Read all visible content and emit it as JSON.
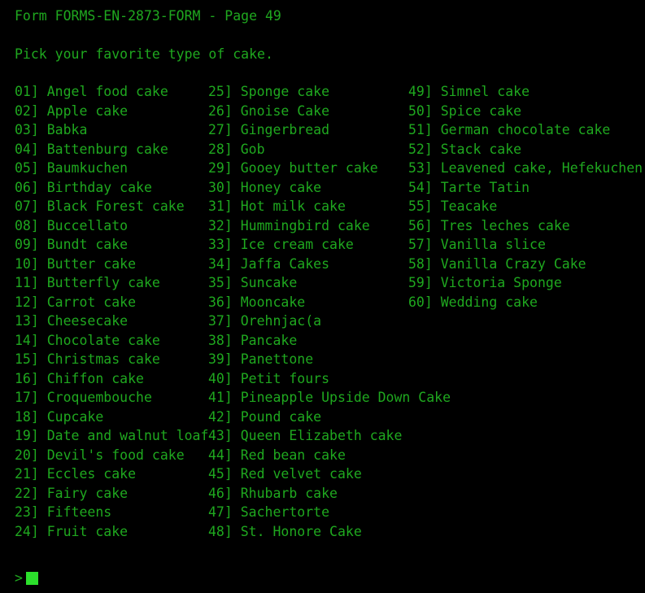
{
  "terminal": {
    "background_color": "#000000",
    "text_color": "#1fa81f",
    "cursor_color": "#2ce02c"
  },
  "header": {
    "title_line": "Form FORMS-EN-2873-FORM - Page 49",
    "form_id": "FORMS-EN-2873-FORM",
    "page_number": "49"
  },
  "prompt_question": "Pick your favorite type of cake.",
  "columns": [
    {
      "name": "column-1",
      "items": [
        {
          "number": "01]",
          "label": "Angel food cake"
        },
        {
          "number": "02]",
          "label": "Apple cake"
        },
        {
          "number": "03]",
          "label": "Babka"
        },
        {
          "number": "04]",
          "label": "Battenburg cake"
        },
        {
          "number": "05]",
          "label": "Baumkuchen"
        },
        {
          "number": "06]",
          "label": "Birthday cake"
        },
        {
          "number": "07]",
          "label": "Black Forest cake"
        },
        {
          "number": "08]",
          "label": "Buccellato"
        },
        {
          "number": "09]",
          "label": "Bundt cake"
        },
        {
          "number": "10]",
          "label": "Butter cake"
        },
        {
          "number": "11]",
          "label": "Butterfly cake"
        },
        {
          "number": "12]",
          "label": "Carrot cake"
        },
        {
          "number": "13]",
          "label": "Cheesecake"
        },
        {
          "number": "14]",
          "label": "Chocolate cake"
        },
        {
          "number": "15]",
          "label": "Christmas cake"
        },
        {
          "number": "16]",
          "label": "Chiffon cake"
        },
        {
          "number": "17]",
          "label": "Croquembouche"
        },
        {
          "number": "18]",
          "label": "Cupcake"
        },
        {
          "number": "19]",
          "label": "Date and walnut loaf"
        },
        {
          "number": "20]",
          "label": "Devil's food cake"
        },
        {
          "number": "21]",
          "label": "Eccles cake"
        },
        {
          "number": "22]",
          "label": "Fairy cake"
        },
        {
          "number": "23]",
          "label": "Fifteens"
        },
        {
          "number": "24]",
          "label": "Fruit cake"
        }
      ]
    },
    {
      "name": "column-2",
      "items": [
        {
          "number": "25]",
          "label": "Sponge cake"
        },
        {
          "number": "26]",
          "label": "Gnoise Cake"
        },
        {
          "number": "27]",
          "label": "Gingerbread"
        },
        {
          "number": "28]",
          "label": "Gob"
        },
        {
          "number": "29]",
          "label": "Gooey butter cake"
        },
        {
          "number": "30]",
          "label": "Honey cake"
        },
        {
          "number": "31]",
          "label": "Hot milk cake"
        },
        {
          "number": "32]",
          "label": "Hummingbird cake"
        },
        {
          "number": "33]",
          "label": "Ice cream cake"
        },
        {
          "number": "34]",
          "label": "Jaffa Cakes"
        },
        {
          "number": "35]",
          "label": "Suncake"
        },
        {
          "number": "36]",
          "label": "Mooncake"
        },
        {
          "number": "37]",
          "label": "Orehnjac(a"
        },
        {
          "number": "38]",
          "label": "Pancake"
        },
        {
          "number": "39]",
          "label": "Panettone"
        },
        {
          "number": "40]",
          "label": "Petit fours"
        },
        {
          "number": "41]",
          "label": "Pineapple Upside Down Cake"
        },
        {
          "number": "42]",
          "label": "Pound cake"
        },
        {
          "number": "43]",
          "label": "Queen Elizabeth cake"
        },
        {
          "number": "44]",
          "label": "Red bean cake"
        },
        {
          "number": "45]",
          "label": "Red velvet cake"
        },
        {
          "number": "46]",
          "label": "Rhubarb cake"
        },
        {
          "number": "47]",
          "label": "Sachertorte"
        },
        {
          "number": "48]",
          "label": "St. Honore Cake"
        }
      ]
    },
    {
      "name": "column-3",
      "items": [
        {
          "number": "49]",
          "label": "Simnel cake"
        },
        {
          "number": "50]",
          "label": "Spice cake"
        },
        {
          "number": "51]",
          "label": "German chocolate cake"
        },
        {
          "number": "52]",
          "label": "Stack cake"
        },
        {
          "number": "53]",
          "label": "Leavened cake, Hefekuchen"
        },
        {
          "number": "54]",
          "label": "Tarte Tatin"
        },
        {
          "number": "55]",
          "label": "Teacake"
        },
        {
          "number": "56]",
          "label": "Tres leches cake"
        },
        {
          "number": "57]",
          "label": "Vanilla slice"
        },
        {
          "number": "58]",
          "label": "Vanilla Crazy Cake"
        },
        {
          "number": "59]",
          "label": "Victoria Sponge"
        },
        {
          "number": "60]",
          "label": "Wedding cake"
        }
      ]
    }
  ],
  "input_line": {
    "sigil": ">",
    "value": "",
    "cursor": "block-cursor"
  }
}
